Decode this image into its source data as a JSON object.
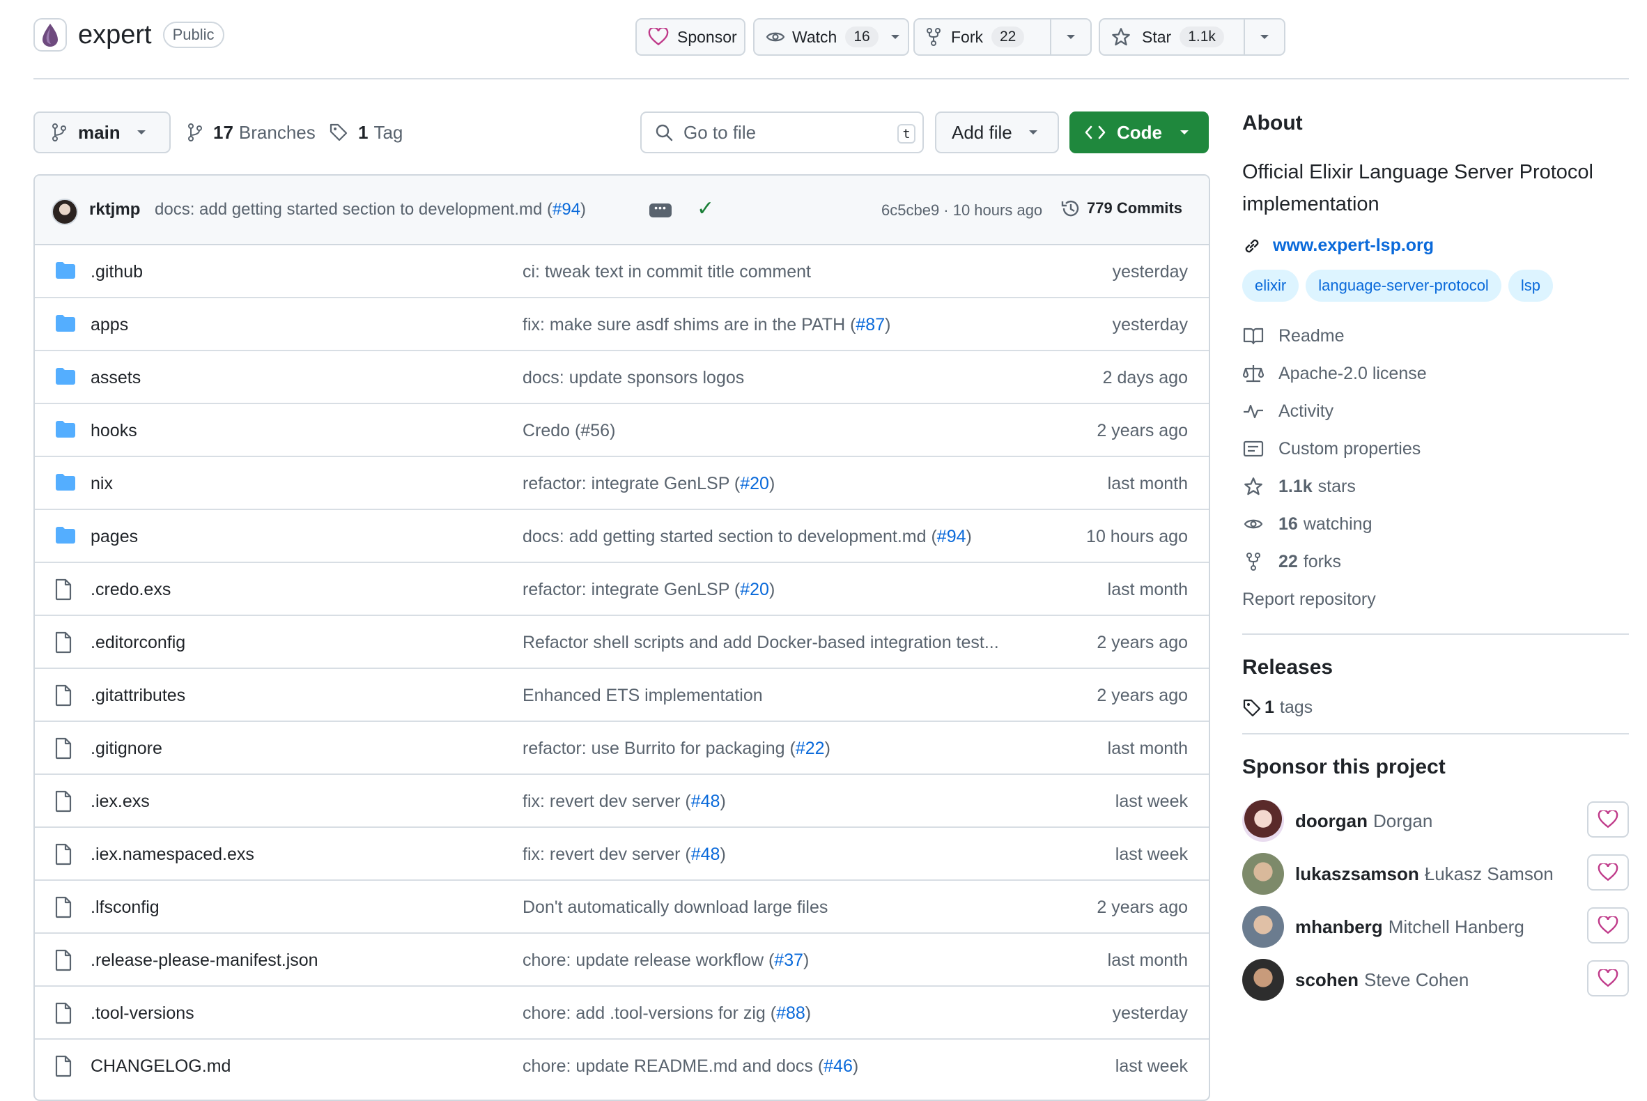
{
  "repo": {
    "name": "expert",
    "visibility": "Public",
    "sponsor_label": "Sponsor",
    "watch_label": "Watch",
    "watch_count": "16",
    "fork_label": "Fork",
    "fork_count": "22",
    "star_label": "Star",
    "star_count": "1.1k"
  },
  "toolbar": {
    "branch": "main",
    "branches_count": "17",
    "branches_label": "Branches",
    "tags_count": "1",
    "tags_label": "Tag",
    "goto_placeholder": "Go to file",
    "goto_shortcut": "t",
    "add_file_label": "Add file",
    "code_label": "Code"
  },
  "last_commit": {
    "author": "rktjmp",
    "message": "docs: add getting started section to development.md (",
    "message_link": "#94",
    "message_end": ")",
    "sha_time": "6c5cbe9 · 10 hours ago",
    "commits_count": "779 Commits"
  },
  "files": [
    {
      "type": "dir",
      "name": ".github",
      "msg": "ci: tweak text in commit title comment",
      "link": "",
      "end": "",
      "date": "yesterday"
    },
    {
      "type": "dir",
      "name": "apps",
      "msg": "fix: make sure asdf shims are in the PATH (",
      "link": "#87",
      "end": ")",
      "date": "yesterday"
    },
    {
      "type": "dir",
      "name": "assets",
      "msg": "docs: update sponsors logos",
      "link": "",
      "end": "",
      "date": "2 days ago"
    },
    {
      "type": "dir",
      "name": "hooks",
      "msg": "Credo (#56)",
      "link": "",
      "end": "",
      "date": "2 years ago"
    },
    {
      "type": "dir",
      "name": "nix",
      "msg": "refactor: integrate GenLSP (",
      "link": "#20",
      "end": ")",
      "date": "last month"
    },
    {
      "type": "dir",
      "name": "pages",
      "msg": "docs: add getting started section to development.md (",
      "link": "#94",
      "end": ")",
      "date": "10 hours ago"
    },
    {
      "type": "file",
      "name": ".credo.exs",
      "msg": "refactor: integrate GenLSP (",
      "link": "#20",
      "end": ")",
      "date": "last month"
    },
    {
      "type": "file",
      "name": ".editorconfig",
      "msg": "Refactor shell scripts and add Docker-based integration test...",
      "link": "",
      "end": "",
      "date": "2 years ago"
    },
    {
      "type": "file",
      "name": ".gitattributes",
      "msg": "Enhanced ETS implementation",
      "link": "",
      "end": "",
      "date": "2 years ago"
    },
    {
      "type": "file",
      "name": ".gitignore",
      "msg": "refactor: use Burrito for packaging (",
      "link": "#22",
      "end": ")",
      "date": "last month"
    },
    {
      "type": "file",
      "name": ".iex.exs",
      "msg": "fix: revert dev server (",
      "link": "#48",
      "end": ")",
      "date": "last week"
    },
    {
      "type": "file",
      "name": ".iex.namespaced.exs",
      "msg": "fix: revert dev server (",
      "link": "#48",
      "end": ")",
      "date": "last week"
    },
    {
      "type": "file",
      "name": ".lfsconfig",
      "msg": "Don't automatically download large files",
      "link": "",
      "end": "",
      "date": "2 years ago"
    },
    {
      "type": "file",
      "name": ".release-please-manifest.json",
      "msg": "chore: update release workflow (",
      "link": "#37",
      "end": ")",
      "date": "last month"
    },
    {
      "type": "file",
      "name": ".tool-versions",
      "msg": "chore: add .tool-versions for zig (",
      "link": "#88",
      "end": ")",
      "date": "yesterday"
    },
    {
      "type": "file",
      "name": "CHANGELOG.md",
      "msg": "chore: update README.md and docs (",
      "link": "#46",
      "end": ")",
      "date": "last week"
    }
  ],
  "about": {
    "heading": "About",
    "description": "Official Elixir Language Server Protocol implementation",
    "website": "www.expert-lsp.org",
    "topics": [
      "elixir",
      "language-server-protocol",
      "lsp"
    ],
    "readme": "Readme",
    "license": "Apache-2.0 license",
    "activity": "Activity",
    "custom_properties": "Custom properties",
    "stars_count": "1.1k",
    "stars_label": "stars",
    "watching_count": "16",
    "watching_label": "watching",
    "forks_count": "22",
    "forks_label": "forks",
    "report": "Report repository"
  },
  "releases": {
    "heading": "Releases",
    "tags_count": "1",
    "tags_label": "tags"
  },
  "sponsors": {
    "heading": "Sponsor this project",
    "list": [
      {
        "login": "doorgan",
        "name": "Dorgan"
      },
      {
        "login": "lukaszsamson",
        "name": "Łukasz Samson"
      },
      {
        "login": "mhanberg",
        "name": "Mitchell Hanberg"
      },
      {
        "login": "scohen",
        "name": "Steve Cohen"
      }
    ]
  },
  "colors": {
    "accent_link": "#0969da",
    "primary_button": "#1f883d",
    "folder": "#54aeff",
    "sponsor_heart": "#bf3989"
  }
}
